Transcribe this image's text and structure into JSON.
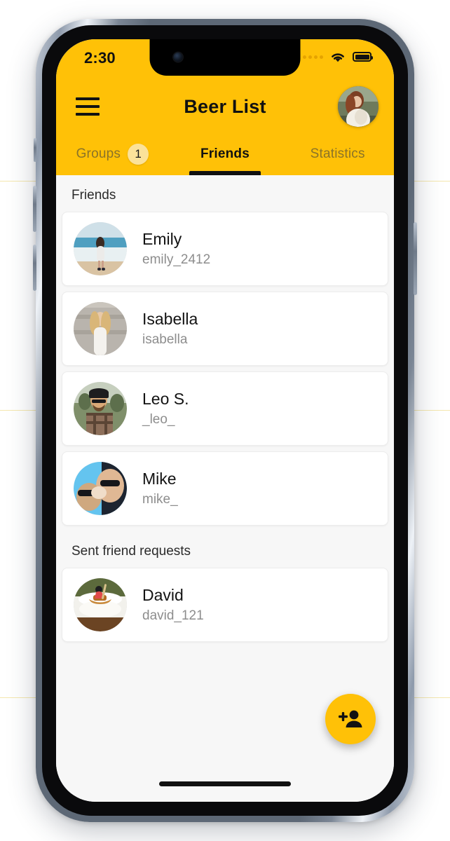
{
  "status_bar": {
    "time": "2:30",
    "signal_icon": "signal-dots-icon",
    "wifi_icon": "wifi-icon",
    "battery_icon": "battery-full-icon"
  },
  "app_bar": {
    "menu_icon": "hamburger-menu-icon",
    "title": "Beer List",
    "avatar_icon": "user-avatar-image"
  },
  "tabs": [
    {
      "label": "Groups",
      "badge": "1",
      "active": false
    },
    {
      "label": "Friends",
      "badge": "",
      "active": true
    },
    {
      "label": "Statistics",
      "badge": "",
      "active": false
    }
  ],
  "sections": [
    {
      "header": "Friends",
      "items": [
        {
          "name": "Emily",
          "handle": "emily_2412"
        },
        {
          "name": "Isabella",
          "handle": "isabella"
        },
        {
          "name": "Leo S.",
          "handle": "_leo_"
        },
        {
          "name": "Mike",
          "handle": "mike_"
        }
      ]
    },
    {
      "header": "Sent friend requests",
      "items": [
        {
          "name": "David",
          "handle": "david_121"
        }
      ]
    }
  ],
  "fab": {
    "icon": "person-add-icon",
    "label": "Add friend"
  },
  "colors": {
    "accent": "#FFC107",
    "badge": "#FBE29A",
    "tab_inactive": "#8A7328",
    "list_bg": "#F7F7F7",
    "card_bg": "#FFFFFF",
    "handle_text": "#8D8D8D"
  }
}
